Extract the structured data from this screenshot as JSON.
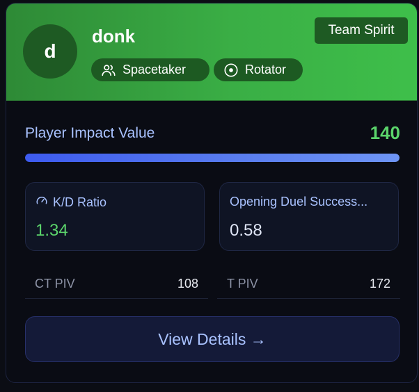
{
  "player": {
    "avatar_initial": "d",
    "name": "donk",
    "roles": [
      {
        "label": "Spacetaker",
        "icon": "users-icon"
      },
      {
        "label": "Rotator",
        "icon": "target-circle-icon"
      }
    ],
    "team": "Team Spirit"
  },
  "impact": {
    "label": "Player Impact Value",
    "value": "140",
    "bar_fraction": 1.0
  },
  "stats": {
    "kd": {
      "label": "K/D Ratio",
      "value": "1.34",
      "icon": "gauge-icon"
    },
    "opening_duel": {
      "label": "Opening Duel Success...",
      "value": "0.58"
    }
  },
  "sides": {
    "ct": {
      "label": "CT PIV",
      "value": "108"
    },
    "t": {
      "label": "T PIV",
      "value": "172"
    }
  },
  "actions": {
    "view_details": "View Details →"
  },
  "colors": {
    "header_green": "#3aae45",
    "accent_green": "#5bd46b",
    "accent_blue": "#a9c2ff",
    "bar_blue": "#3d5bf0"
  }
}
